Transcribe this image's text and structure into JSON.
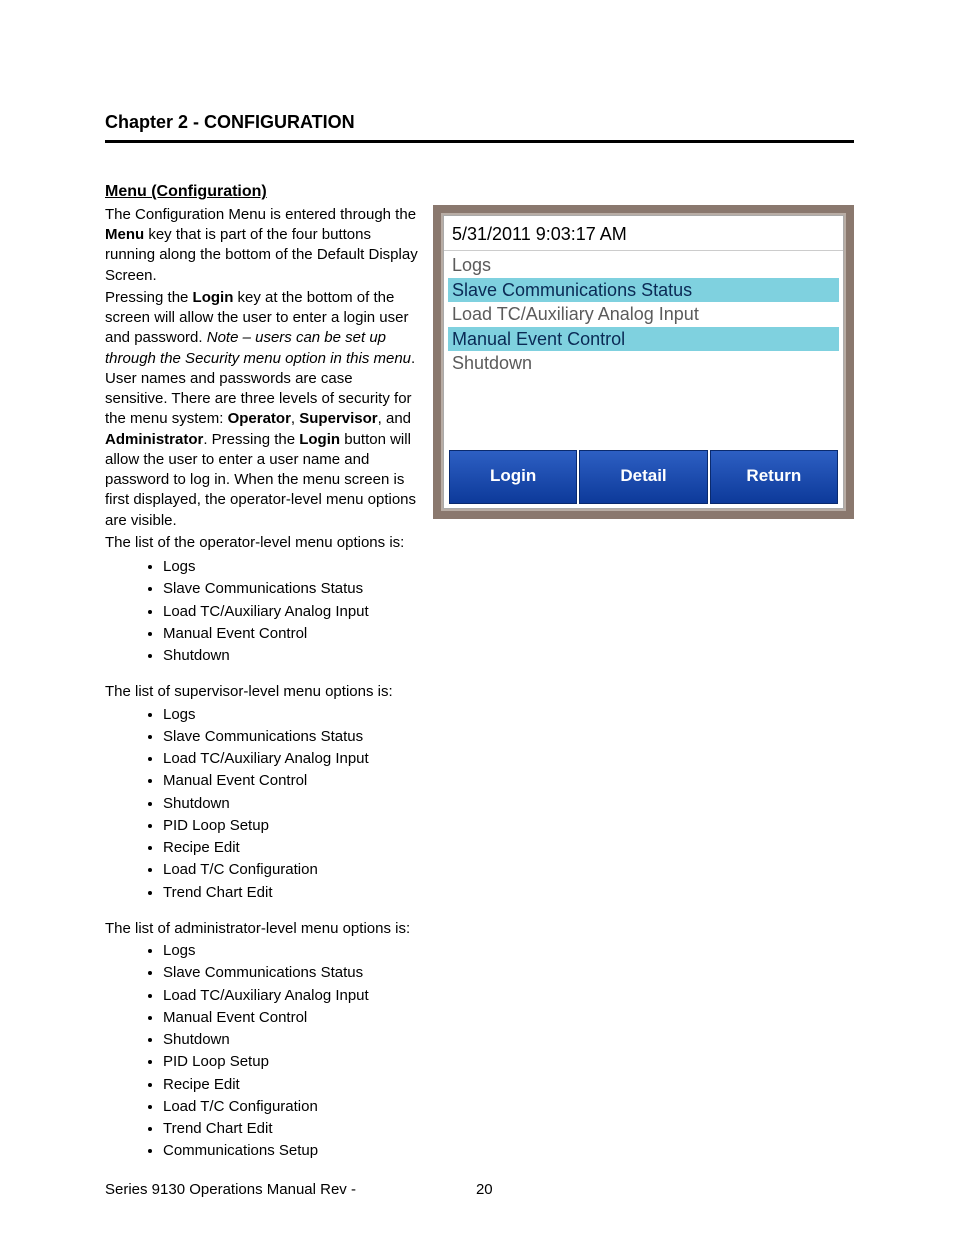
{
  "chapter_title": "Chapter 2 - CONFIGURATION",
  "section_title": "Menu (Configuration)",
  "intro": {
    "t1a": "The Configuration Menu is entered through the ",
    "t1b": "Menu",
    "t1c": " key that is part of the four buttons running along the bottom of the Default Display Screen.",
    "t2a": "Pressing the ",
    "t2b": "Login",
    "t2c": " key at the bottom of the screen will allow the user to enter a login user and password.  ",
    "t2d": "Note – users can be set up through the Security menu option in this menu",
    "t2e": ".   User names and passwords are case sensitive.  There are three levels of security for the menu system: ",
    "t2f": "Operator",
    "t2g": ", ",
    "t2h": "Supervisor",
    "t2i": ", and ",
    "t2j": "Administrator",
    "t2k": ".  Pressing the ",
    "t2l": "Login",
    "t2m": " button will allow the user to enter a user name and password to log in.  When the menu screen is first displayed, the operator-level menu options are visible.",
    "t3": "The list of the operator-level menu options is:"
  },
  "operator_list": [
    "Logs",
    "Slave Communications Status",
    "Load TC/Auxiliary Analog Input",
    "Manual Event Control",
    "Shutdown"
  ],
  "sup_intro": "The list of supervisor-level menu options is:",
  "supervisor_list": [
    "Logs",
    "Slave Communications Status",
    "Load TC/Auxiliary Analog Input",
    "Manual Event Control",
    "Shutdown",
    "PID Loop Setup",
    "Recipe Edit",
    "Load T/C Configuration",
    "Trend Chart Edit"
  ],
  "admin_intro": "The list of administrator-level menu options is:",
  "admin_list": [
    "Logs",
    "Slave Communications Status",
    "Load TC/Auxiliary Analog Input",
    "Manual Event Control",
    "Shutdown",
    "PID Loop Setup",
    "Recipe Edit",
    "Load T/C Configuration",
    "Trend Chart Edit",
    "Communications Setup"
  ],
  "device": {
    "timestamp": "5/31/2011 9:03:17 AM",
    "rows": [
      {
        "label": "Logs",
        "hl": false
      },
      {
        "label": "Slave Communications Status",
        "hl": true
      },
      {
        "label": "Load TC/Auxiliary Analog Input",
        "hl": false
      },
      {
        "label": "Manual Event Control",
        "hl": true
      },
      {
        "label": "Shutdown",
        "hl": false
      }
    ],
    "buttons": [
      "Login",
      "Detail",
      "Return"
    ]
  },
  "footer": {
    "title": "Series 9130 Operations Manual Rev -",
    "page": "20"
  }
}
